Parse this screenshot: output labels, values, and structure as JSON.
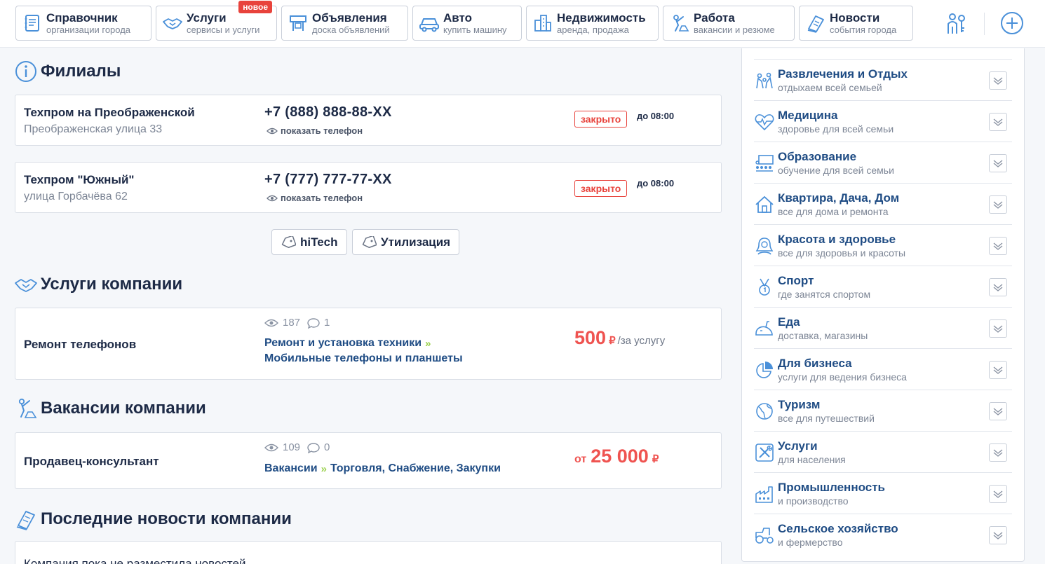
{
  "nav": [
    {
      "title": "Справочник",
      "subtitle": "организации города",
      "icon": "book-icon"
    },
    {
      "title": "Услуги",
      "subtitle": "сервисы и услуги",
      "icon": "handshake-icon",
      "badge": "новое"
    },
    {
      "title": "Объявления",
      "subtitle": "доска объявлений",
      "icon": "board-icon"
    },
    {
      "title": "Авто",
      "subtitle": "купить машину",
      "icon": "car-icon"
    },
    {
      "title": "Недвижимость",
      "subtitle": "аренда, продажа",
      "icon": "buildings-icon"
    },
    {
      "title": "Работа",
      "subtitle": "вакансии и резюме",
      "icon": "worker-icon"
    },
    {
      "title": "Новости",
      "subtitle": "события города",
      "icon": "newspaper-icon"
    }
  ],
  "branches": {
    "title": "Филиалы",
    "items": [
      {
        "name": "Техпром на Преображенской",
        "address": "Преображенская улица 33",
        "phone": "+7 (888) 888-88-XX",
        "show_phone": "показать телефон",
        "status": "закрыто",
        "until": "до 08:00"
      },
      {
        "name": "Техпром \"Южный\"",
        "address": "улица Горбачёва 62",
        "phone": "+7 (777) 777-77-XX",
        "show_phone": "показать телефон",
        "status": "закрыто",
        "until": "до 08:00"
      }
    ]
  },
  "tags": [
    "hiTech",
    "Утилизация"
  ],
  "services": {
    "title": "Услуги компании",
    "item": {
      "name": "Ремонт телефонов",
      "views": "187",
      "comments": "1",
      "category": "Ремонт и установка техники",
      "subcategory": "Мобильные телефоны и планшеты",
      "price": "500",
      "currency": "₽",
      "unit": "/за услугу"
    }
  },
  "vacancies": {
    "title": "Вакансии компании",
    "item": {
      "name": "Продавец-консультант",
      "views": "109",
      "comments": "0",
      "category": "Вакансии",
      "subcategory": "Торговля, Снабжение, Закупки",
      "price_prefix": "от",
      "price": "25 000",
      "currency": "₽"
    }
  },
  "news": {
    "title": "Последние новости компании",
    "empty_text": "Компания пока не разместила новостей"
  },
  "sidebar": [
    {
      "title": "Развлечения и Отдых",
      "subtitle": "отдыхаем всей семьей",
      "icon": "family-icon"
    },
    {
      "title": "Медицина",
      "subtitle": "здоровье для всей семьи",
      "icon": "heartbeat-icon"
    },
    {
      "title": "Образование",
      "subtitle": "обучение для всей семьи",
      "icon": "classroom-icon"
    },
    {
      "title": "Квартира, Дача, Дом",
      "subtitle": "все для дома и ремонта",
      "icon": "house-icon"
    },
    {
      "title": "Красота и здоровье",
      "subtitle": "все для здоровья и красоты",
      "icon": "woman-icon"
    },
    {
      "title": "Спорт",
      "subtitle": "где занятся спортом",
      "icon": "medal-icon"
    },
    {
      "title": "Еда",
      "subtitle": "доставка, магазины",
      "icon": "food-icon"
    },
    {
      "title": "Для бизнеса",
      "subtitle": "услуги для ведения бизнеса",
      "icon": "pie-chart-icon"
    },
    {
      "title": "Туризм",
      "subtitle": "все для путешествий",
      "icon": "globe-icon"
    },
    {
      "title": "Услуги",
      "subtitle": "для населения",
      "icon": "tools-icon"
    },
    {
      "title": "Промышленность",
      "subtitle": "и производство",
      "icon": "factory-icon"
    },
    {
      "title": "Сельское хозяйство",
      "subtitle": "и фермерство",
      "icon": "tractor-icon"
    }
  ],
  "colors": {
    "accent": "#4a90d9",
    "price": "#ef5350",
    "link": "#1f4c84",
    "arrow": "#9bd14f"
  }
}
